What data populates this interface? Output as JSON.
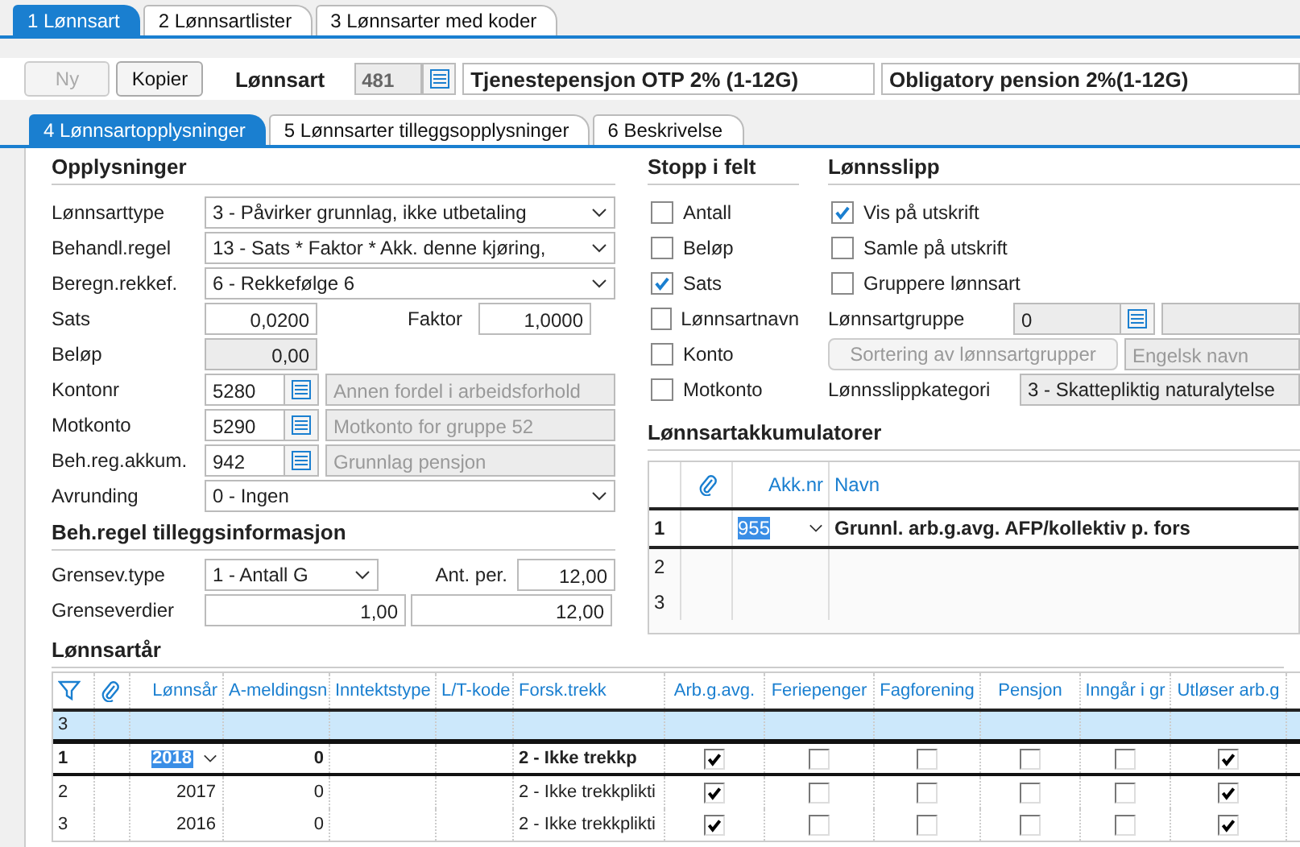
{
  "top_tabs": [
    {
      "label": "1 Lønnsart",
      "selected": true
    },
    {
      "label": "2 Lønnsartlister",
      "selected": false
    },
    {
      "label": "3 Lønnsarter med koder",
      "selected": false
    }
  ],
  "toolbar": {
    "buttons": [
      {
        "label": "Ny",
        "disabled": true
      },
      {
        "label": "Kopier",
        "disabled": false
      }
    ],
    "label": "Lønnsart",
    "code": "481",
    "name": "Tjenestepensjon OTP 2% (1-12G)",
    "english_name": "Obligatory pension 2%(1-12G)"
  },
  "sub_tabs": [
    {
      "label": "4 Lønnsartopplysninger",
      "selected": true
    },
    {
      "label": "5 Lønnsarter tilleggsopplysninger",
      "selected": false
    },
    {
      "label": "6 Beskrivelse",
      "selected": false
    }
  ],
  "opplysninger": {
    "title": "Opplysninger",
    "rows": [
      {
        "kind": "select",
        "label": "Lønnsarttype",
        "value": "3 - Påvirker grunnlag, ikke utbetaling"
      },
      {
        "kind": "select",
        "label": "Behandl.regel",
        "value": "13 - Sats * Faktor * Akk. denne kjøring,"
      },
      {
        "kind": "select",
        "label": "Beregn.rekkef.",
        "value": "6 - Rekkefølge 6"
      },
      {
        "kind": "pair",
        "label": "Sats",
        "value": "0,0200",
        "extra_label": "Faktor",
        "extra_value": "1,0000"
      },
      {
        "kind": "readonly",
        "label": "Beløp",
        "value": "0,00"
      },
      {
        "kind": "lookup",
        "label": "Kontonr",
        "value": "5280",
        "description": "Annen fordel i arbeidsforhold"
      },
      {
        "kind": "lookup",
        "label": "Motkonto",
        "value": "5290",
        "description": "Motkonto for gruppe 52"
      },
      {
        "kind": "lookup",
        "label": "Beh.reg.akkum.",
        "value": "942",
        "description": "Grunnlag pensjon"
      },
      {
        "kind": "select",
        "label": "Avrunding",
        "value": "0 - Ingen"
      }
    ]
  },
  "tillegg": {
    "title": "Beh.regel tilleggsinformasjon",
    "type_label": "Grensev.type",
    "type_value": "1 - Antall G",
    "periods_label": "Ant. per.",
    "periods": "12,00",
    "limits_label": "Grenseverdier",
    "limit_from": "1,00",
    "limit_to": "12,00"
  },
  "stopp": {
    "title": "Stopp i felt",
    "items": [
      {
        "label": "Antall",
        "checked": false
      },
      {
        "label": "Beløp",
        "checked": false
      },
      {
        "label": "Sats",
        "checked": true
      },
      {
        "label": "Lønnsartnavn",
        "checked": false
      },
      {
        "label": "Konto",
        "checked": false
      },
      {
        "label": "Motkonto",
        "checked": false
      }
    ]
  },
  "lonnsslipp": {
    "title": "Lønnsslipp",
    "checkboxes": [
      {
        "label": "Vis på utskrift",
        "checked": true
      },
      {
        "label": "Samle på utskrift",
        "checked": false
      },
      {
        "label": "Gruppere lønnsart",
        "checked": false
      }
    ],
    "group_label": "Lønnsartgruppe",
    "group_code": "0",
    "sort_button": {
      "label": "Sortering av lønnsartgrupper",
      "disabled": true
    },
    "english_placeholder": "Engelsk navn",
    "category_label": "Lønnsslippkategori",
    "category": "3 - Skattepliktig naturalytelse"
  },
  "akkumulatorer": {
    "title": "Lønnsartakkumulatorer",
    "columns": [
      "Akk.nr",
      "Navn"
    ],
    "rows": [
      {
        "number": "1",
        "akk_nr": "955",
        "name": "Grunnl. arb.g.avg. AFP/kollektiv p. fors",
        "selected": true
      },
      {
        "number": "2",
        "selected": false
      },
      {
        "number": "3",
        "selected": false
      }
    ]
  },
  "lonnsartar": {
    "title": "Lønnsartår",
    "columns": [
      "Lønnsår",
      "A-meldingsn",
      "Inntektstype",
      "L/T-kode",
      "Forsk.trekk",
      "Arb.g.avg.",
      "Feriepenger",
      "Fagforening",
      "Pensjon",
      "Inngår i gr",
      "Utløser arb.g"
    ],
    "new_row": "3",
    "rows": [
      {
        "number": "1",
        "year": "2018",
        "a_melding": "0",
        "forsk_trekk": "2 - Ikke trekkp",
        "flags": [
          true,
          false,
          false,
          false,
          false,
          true
        ],
        "selected": true
      },
      {
        "number": "2",
        "year": "2017",
        "a_melding": "0",
        "forsk_trekk": "2 - Ikke trekkplikti",
        "flags": [
          true,
          false,
          false,
          false,
          false,
          true
        ],
        "selected": false
      },
      {
        "number": "3",
        "year": "2016",
        "a_melding": "0",
        "forsk_trekk": "2 - Ikke trekkplikti",
        "flags": [
          true,
          false,
          false,
          false,
          false,
          true
        ],
        "selected": false
      }
    ]
  }
}
